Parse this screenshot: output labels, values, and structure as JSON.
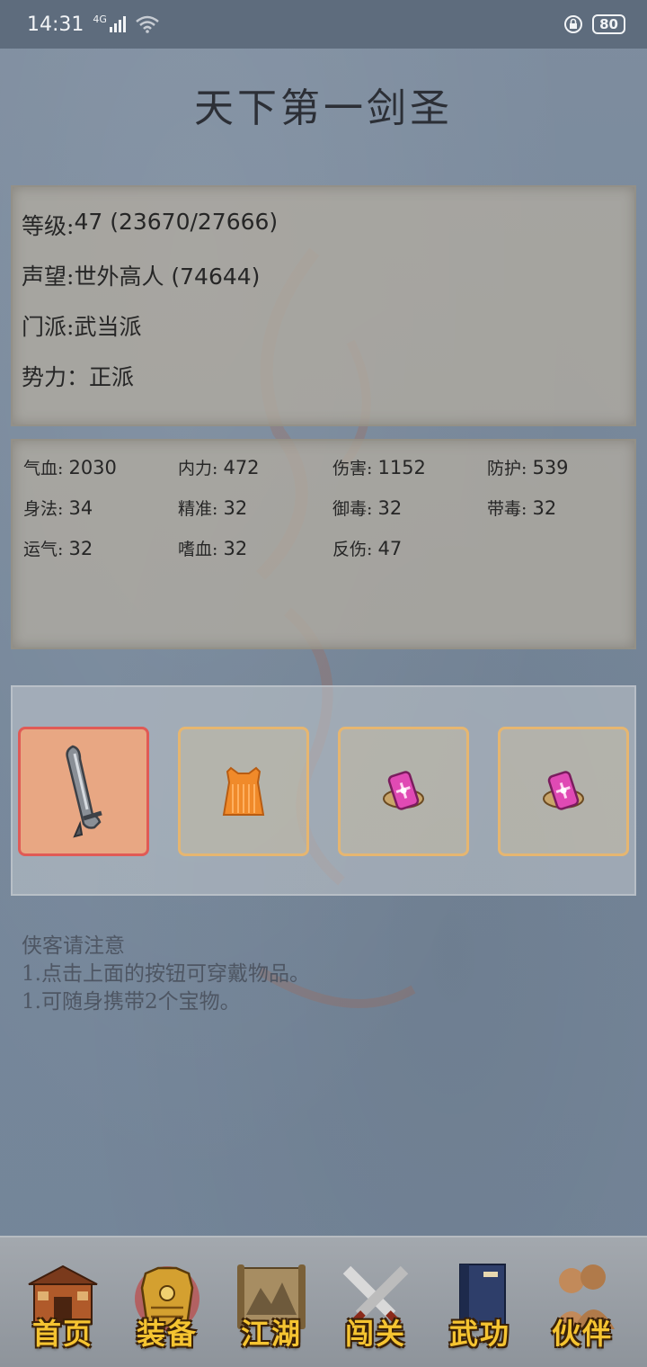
{
  "status_bar": {
    "time": "14:31",
    "network": "4G",
    "battery": "80"
  },
  "title": "天下第一剑圣",
  "info": [
    {
      "key": "等级: ",
      "value": "47 (23670/27666)"
    },
    {
      "key": "声望: ",
      "value": "世外高人 (74644)"
    },
    {
      "key": "门派: ",
      "value": "武当派"
    },
    {
      "key": "势力： ",
      "value": "正派"
    }
  ],
  "stats": [
    {
      "key": "气血: ",
      "value": "2030"
    },
    {
      "key": "内力: ",
      "value": "472"
    },
    {
      "key": "伤害: ",
      "value": "1152"
    },
    {
      "key": "防护: ",
      "value": "539"
    },
    {
      "key": "身法: ",
      "value": "34"
    },
    {
      "key": "精准: ",
      "value": "32"
    },
    {
      "key": "御毒: ",
      "value": "32"
    },
    {
      "key": "带毒: ",
      "value": "32"
    },
    {
      "key": "运气: ",
      "value": "32"
    },
    {
      "key": "嗜血: ",
      "value": "32"
    },
    {
      "key": "反伤: ",
      "value": "47"
    }
  ],
  "equipment": [
    {
      "icon": "sword-icon",
      "selected": true
    },
    {
      "icon": "armor-icon",
      "selected": false
    },
    {
      "icon": "treasure-icon",
      "selected": false
    },
    {
      "icon": "treasure-icon",
      "selected": false
    }
  ],
  "notes": [
    "侠客请注意",
    "1.点击上面的按钮可穿戴物品。",
    "1.可随身携带2个宝物。"
  ],
  "nav": [
    {
      "label": "首页",
      "icon": "house-icon"
    },
    {
      "label": "装备",
      "icon": "armor-icon",
      "active": true
    },
    {
      "label": "江湖",
      "icon": "scroll-map-icon"
    },
    {
      "label": "闯关",
      "icon": "crossed-swords-icon"
    },
    {
      "label": "武功",
      "icon": "book-icon"
    },
    {
      "label": "伙伴",
      "icon": "people-icon"
    }
  ],
  "colors": {
    "background": "#7a8a9c",
    "nav_label": "#f5c431",
    "slot_border": "#e6b670",
    "slot_selected_border": "#e05a55"
  }
}
